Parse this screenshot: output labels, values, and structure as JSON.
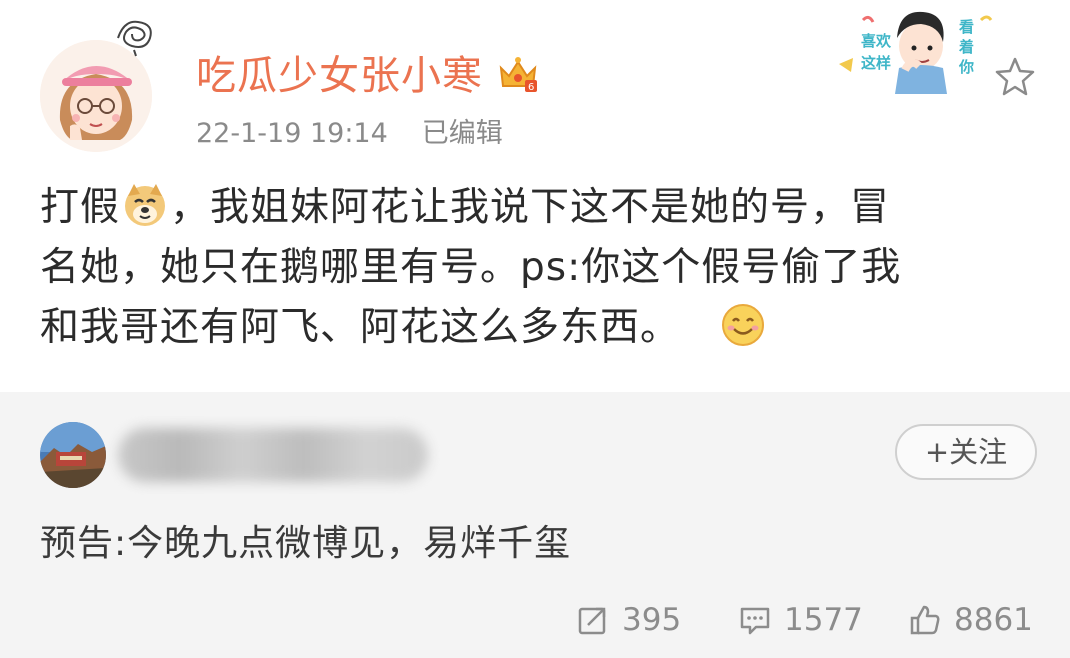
{
  "post": {
    "username": "吃瓜少女张小寒",
    "time": "22-1-19 19:14",
    "edited": "已编辑",
    "content_line1_a": "打假",
    "content_line1_b": "，我姐妹阿花让我说下这不是她的号，冒",
    "content_line2": "名她，她只在鹅哪里有号。ps:你这个假号偷了我",
    "content_line3": "和我哥还有阿飞、阿花这么多东西。",
    "sticker_text_left": "喜欢这样",
    "sticker_text_right": "看着你"
  },
  "repost": {
    "follow_label": "+关注",
    "text": "预告:今晚九点微博见，易烊千玺",
    "stats": {
      "repost_count": "395",
      "comment_count": "1577",
      "like_count": "8861"
    }
  },
  "colors": {
    "username": "#eb7350",
    "meta": "#8a8a8a",
    "repost_bg": "#f4f4f4"
  },
  "icons": [
    "avatar-girl",
    "crown-icon",
    "star-icon",
    "doge-emoji",
    "smile-emoji",
    "repost-icon",
    "comment-icon",
    "like-icon"
  ]
}
